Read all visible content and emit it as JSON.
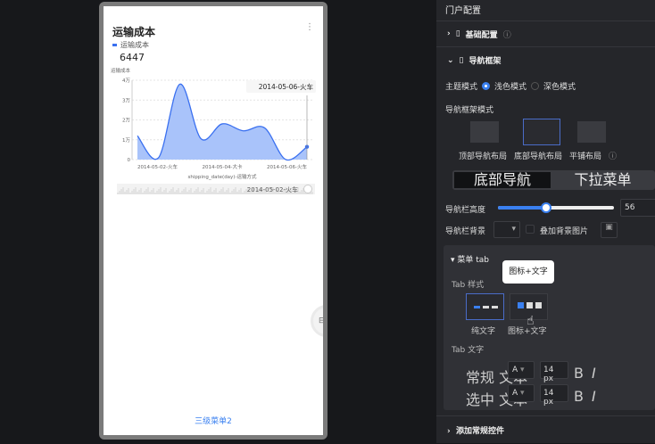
{
  "chart_card": {
    "title": "运输成本",
    "legend": "运输成本",
    "kpi": "6447",
    "more_icon": "more-vertical-icon"
  },
  "chart_data": {
    "type": "area",
    "title": "",
    "ylabel": "运输成本",
    "xlabel": "shipping_date(day)-运输方式",
    "ylim": [
      0,
      40000
    ],
    "yticks": [
      {
        "v": 0,
        "l": "0"
      },
      {
        "v": 10000,
        "l": "1万"
      },
      {
        "v": 20000,
        "l": "2万"
      },
      {
        "v": 30000,
        "l": "3万"
      },
      {
        "v": 40000,
        "l": "4万"
      }
    ],
    "xticks": [
      {
        "i": 0,
        "l": "2014-05-02-火车"
      },
      {
        "i": 4,
        "l": "2014-05-04-大卡"
      },
      {
        "i": 8,
        "l": "2014-05-06-火车"
      }
    ],
    "values": [
      12000,
      1000,
      38000,
      10500,
      18000,
      14500,
      16000,
      0,
      6447
    ],
    "tooltip": "2014-05-06-火车",
    "slider_label": "2014-05-02-火车",
    "grid": true,
    "color": "#3a70f0"
  },
  "phone": {
    "bottom_tab": "三级菜单2"
  },
  "panel": {
    "title": "门户配置",
    "basic": "基础配置",
    "nav": "导航框架",
    "theme_label": "主题模式",
    "theme_light": "浅色模式",
    "theme_dark": "深色模式",
    "nav_mode_label": "导航框架模式",
    "layouts": [
      "顶部导航布局",
      "底部导航布局",
      "平铺布局"
    ],
    "seg": [
      "底部导航",
      "下拉菜单"
    ],
    "height_label": "导航栏高度",
    "height_value": "56",
    "height_fraction": 0.4,
    "bg_label": "导航栏背景",
    "overlay_label": "叠加背景图片",
    "menu_tab": "菜单 tab",
    "tab_style": "Tab 样式",
    "styles": [
      "纯文字",
      "图标+文字"
    ],
    "tooltip": "图标+文字",
    "tab_text": "Tab 文字",
    "normal": "常规 文本",
    "selected": "选中 文本",
    "font_a": "A",
    "size": "14 px",
    "bold": "B",
    "italic": "I",
    "add_controls": "添加常规控件",
    "accent": "#3a80f0"
  }
}
